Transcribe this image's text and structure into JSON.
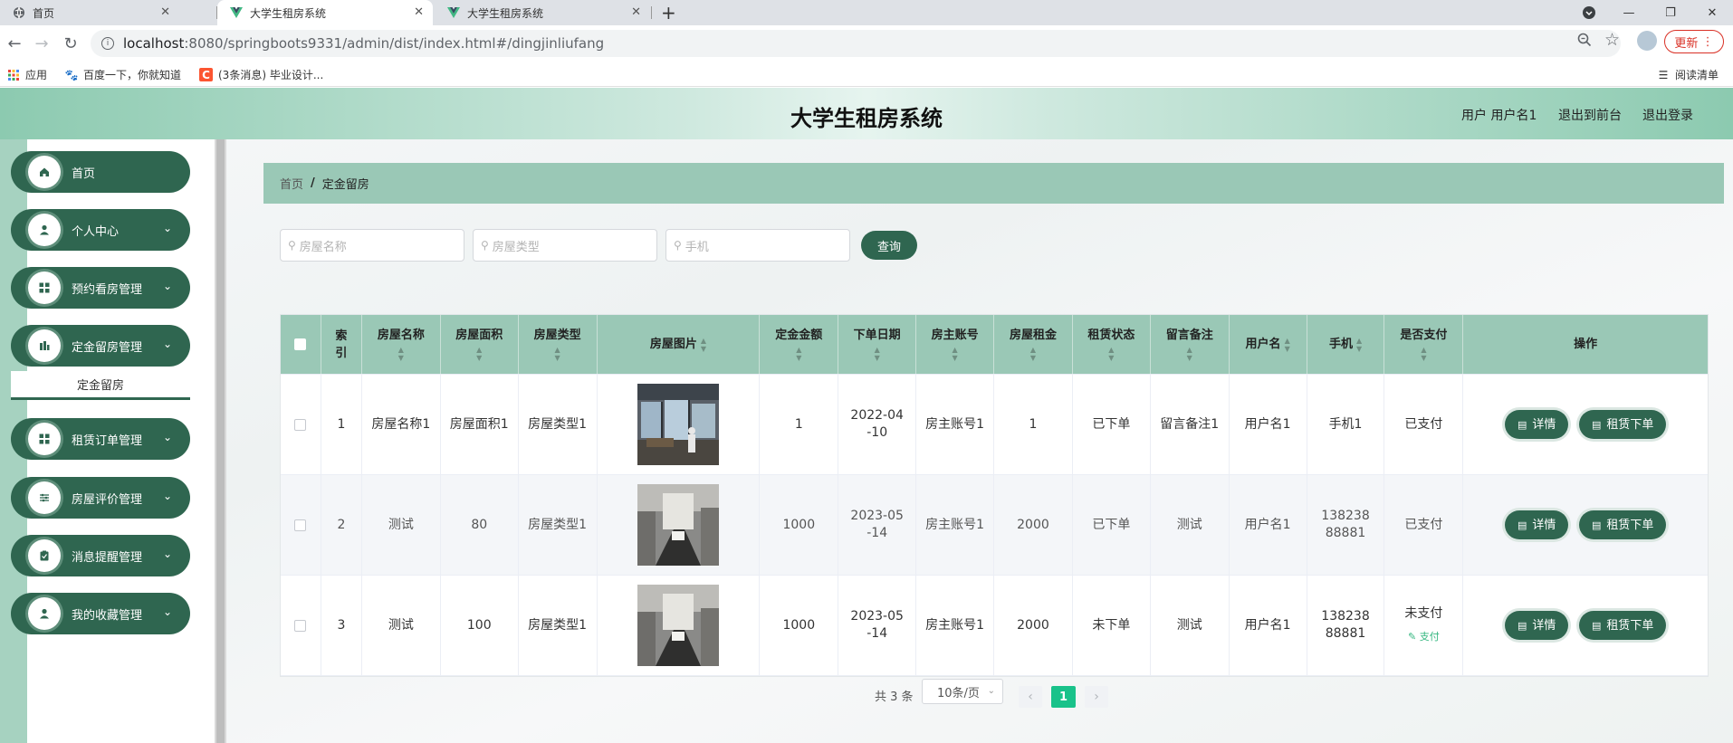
{
  "browser": {
    "tabs": [
      {
        "title": "首页",
        "icon": "globe-icon"
      },
      {
        "title": "大学生租房系统",
        "icon": "vue-logo-icon"
      },
      {
        "title": "大学生租房系统",
        "icon": "vue-logo-icon"
      }
    ],
    "url_host": "localhost",
    "url_rest": ":8080/springboots9331/admin/dist/index.html#/dingjinliufang",
    "update_label": "更新",
    "bookmarks": [
      {
        "label": "应用",
        "icon": "apps-grid-icon"
      },
      {
        "label": "百度一下，你就知道",
        "icon": "baidu-paw-icon"
      },
      {
        "label": "(3条消息) 毕业设计...",
        "icon": "csdn-c-icon"
      }
    ],
    "reading_list": "阅读清单"
  },
  "header": {
    "title": "大学生租房系统",
    "user_label": "用户 用户名1",
    "front_label": "退出到前台",
    "logout_label": "退出登录"
  },
  "sidebar": {
    "items": [
      {
        "label": "首页",
        "icon": "home-icon",
        "has_arrow": false
      },
      {
        "label": "个人中心",
        "icon": "user-icon",
        "has_arrow": true
      },
      {
        "label": "预约看房管理",
        "icon": "grid-icon",
        "has_arrow": true
      },
      {
        "label": "定金留房管理",
        "icon": "building-icon",
        "has_arrow": true
      },
      {
        "label": "租赁订单管理",
        "icon": "grid-icon",
        "has_arrow": true
      },
      {
        "label": "房屋评价管理",
        "icon": "sliders-icon",
        "has_arrow": true
      },
      {
        "label": "消息提醒管理",
        "icon": "clipboard-icon",
        "has_arrow": true
      },
      {
        "label": "我的收藏管理",
        "icon": "user-icon",
        "has_arrow": true
      }
    ],
    "active_sub": "定金留房"
  },
  "breadcrumb": {
    "home": "首页",
    "sep": "/",
    "current": "定金留房"
  },
  "search": {
    "name_placeholder": "房屋名称",
    "type_placeholder": "房屋类型",
    "phone_placeholder": "手机",
    "button": "查询"
  },
  "table": {
    "headers": [
      "索引",
      "房屋名称",
      "房屋面积",
      "房屋类型",
      "房屋图片",
      "定金金额",
      "下单日期",
      "房主账号",
      "房屋租金",
      "租赁状态",
      "留言备注",
      "用户名",
      "手机",
      "是否支付",
      "操作"
    ],
    "rows": [
      {
        "index": "1",
        "name": "房屋名称1",
        "area": "房屋面积1",
        "type": "房屋类型1",
        "deposit": "1",
        "date": "2022-04-10",
        "owner": "房主账号1",
        "rent": "1",
        "status": "已下单",
        "note": "留言备注1",
        "user": "用户名1",
        "phone": "手机1",
        "paid": "已支付",
        "pay_link": ""
      },
      {
        "index": "2",
        "name": "测试",
        "area": "80",
        "type": "房屋类型1",
        "deposit": "1000",
        "date": "2023-05-14",
        "owner": "房主账号1",
        "rent": "2000",
        "status": "已下单",
        "note": "测试",
        "user": "用户名1",
        "phone": "13823888881",
        "paid": "已支付",
        "pay_link": ""
      },
      {
        "index": "3",
        "name": "测试",
        "area": "100",
        "type": "房屋类型1",
        "deposit": "1000",
        "date": "2023-05-14",
        "owner": "房主账号1",
        "rent": "2000",
        "status": "未下单",
        "note": "测试",
        "user": "用户名1",
        "phone": "13823888881",
        "paid": "未支付",
        "pay_link": "支付"
      }
    ],
    "detail_label": "详情",
    "order_label": "租赁下单"
  },
  "pagination": {
    "total": "共 3 条",
    "page_size": "10条/页",
    "current": "1"
  },
  "colors": {
    "primary": "#2f6650",
    "header_bg": "#9ac8b6",
    "accent": "#19c28a"
  }
}
